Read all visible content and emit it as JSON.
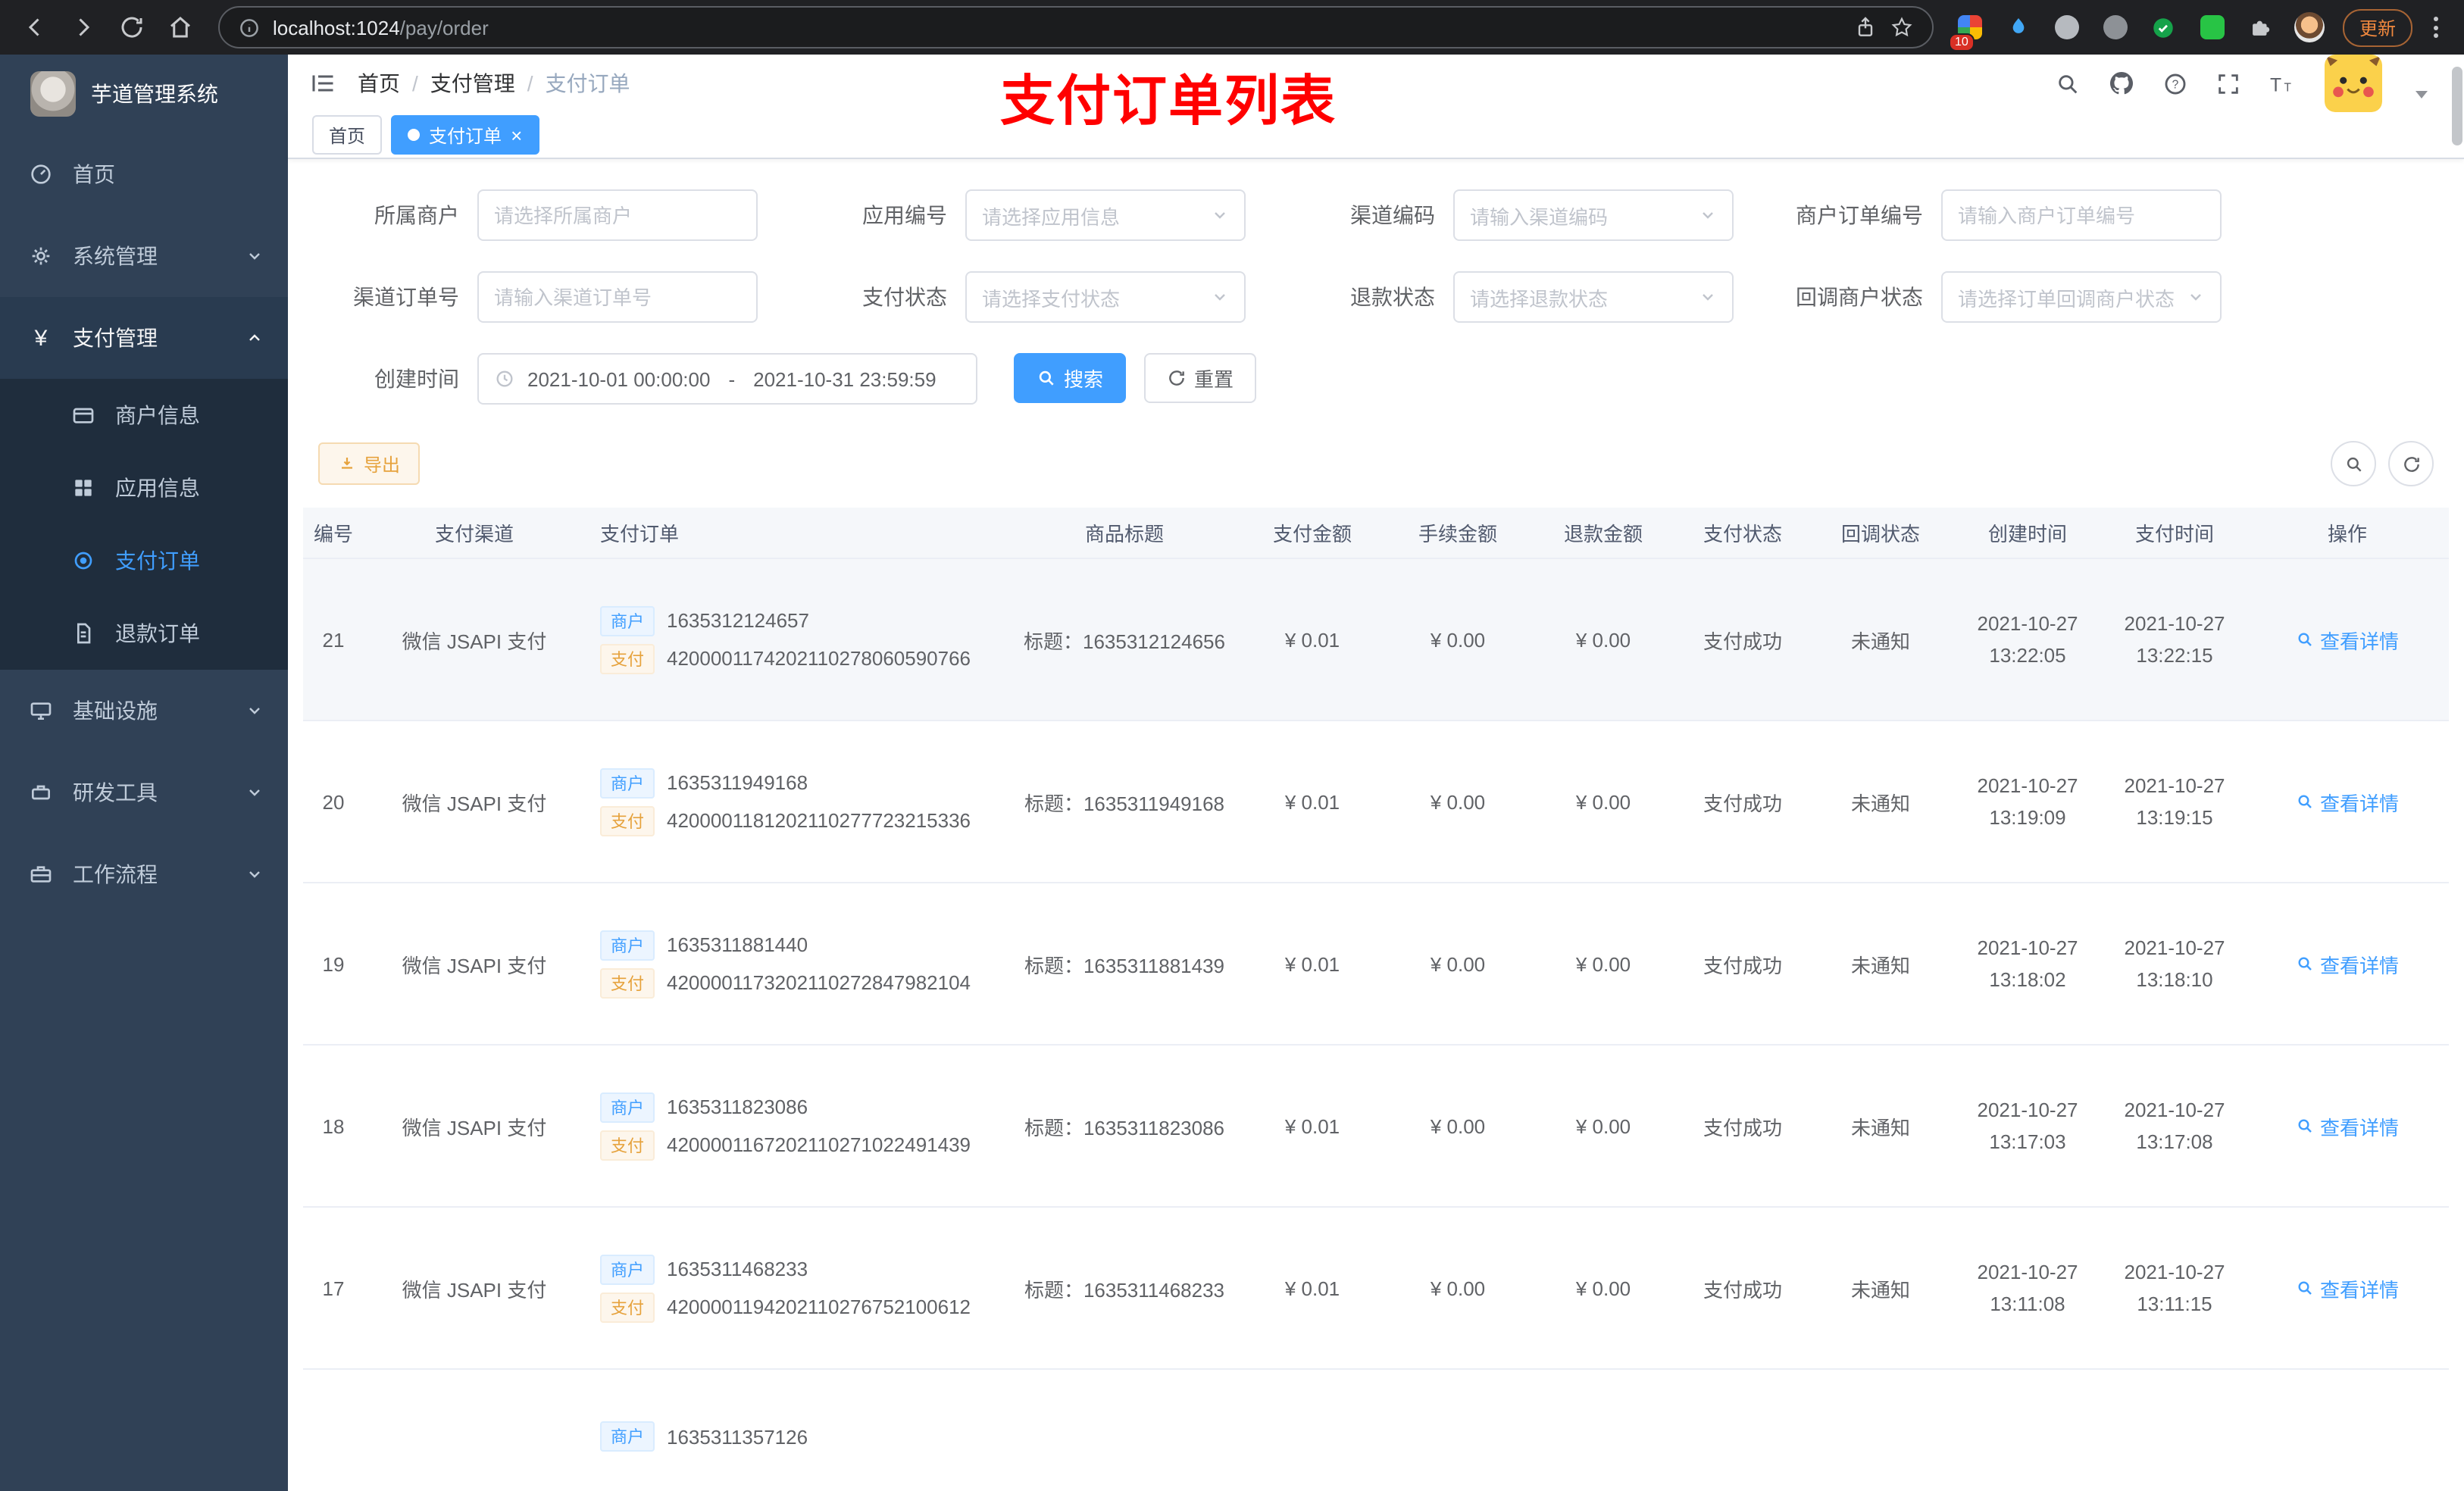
{
  "browser": {
    "url_host": "localhost:1024",
    "url_path": "/pay/order",
    "extension_badge": "10",
    "update_label": "更新"
  },
  "app": {
    "logo_title": "芋道管理系统"
  },
  "sidebar": {
    "items": [
      {
        "label": "首页"
      },
      {
        "label": "系统管理"
      },
      {
        "label": "支付管理"
      },
      {
        "label": "基础设施"
      },
      {
        "label": "研发工具"
      },
      {
        "label": "工作流程"
      }
    ],
    "submenu": [
      {
        "label": "商户信息"
      },
      {
        "label": "应用信息"
      },
      {
        "label": "支付订单"
      },
      {
        "label": "退款订单"
      }
    ]
  },
  "header": {
    "breadcrumb": [
      "首页",
      "支付管理",
      "支付订单"
    ],
    "separator": "/",
    "annotation": "支付订单列表"
  },
  "tabs": [
    {
      "label": "首页"
    },
    {
      "label": "支付订单"
    }
  ],
  "icons": {
    "pay_menu_glyph": "¥",
    "close_glyph": "×",
    "help_glyph": "?"
  },
  "filters": {
    "merchant": {
      "label": "所属商户",
      "placeholder": "请选择所属商户"
    },
    "app_no": {
      "label": "应用编号",
      "placeholder": "请选择应用信息"
    },
    "channel_code": {
      "label": "渠道编码",
      "placeholder": "请输入渠道编码"
    },
    "merchant_order_no": {
      "label": "商户订单编号",
      "placeholder": "请输入商户订单编号"
    },
    "channel_order_no": {
      "label": "渠道订单号",
      "placeholder": "请输入渠道订单号"
    },
    "pay_status": {
      "label": "支付状态",
      "placeholder": "请选择支付状态"
    },
    "refund_status": {
      "label": "退款状态",
      "placeholder": "请选择退款状态"
    },
    "callback_status": {
      "label": "回调商户状态",
      "placeholder": "请选择订单回调商户状态"
    },
    "create_time": {
      "label": "创建时间",
      "start": "2021-10-01 00:00:00",
      "separator": "-",
      "end": "2021-10-31 23:59:59"
    },
    "search_label": "搜索",
    "reset_label": "重置"
  },
  "toolbar": {
    "export_label": "导出"
  },
  "table": {
    "headers": [
      "编号",
      "支付渠道",
      "支付订单",
      "商品标题",
      "支付金额",
      "手续金额",
      "退款金额",
      "支付状态",
      "回调状态",
      "创建时间",
      "支付时间",
      "操作"
    ],
    "merchant_tag": "商户",
    "pay_tag": "支付",
    "action_label": "查看详情",
    "rows": [
      {
        "id": "21",
        "channel": "微信 JSAPI 支付",
        "merchant_no": "1635312124657",
        "channel_no": "4200001174202110278060590766",
        "title": "标题：1635312124656",
        "amount": "¥ 0.01",
        "fee": "¥ 0.00",
        "refund": "¥ 0.00",
        "status": "支付成功",
        "notify": "未通知",
        "create_date": "2021-10-27",
        "create_time": "13:22:05",
        "pay_date": "2021-10-27",
        "pay_time": "13:22:15"
      },
      {
        "id": "20",
        "channel": "微信 JSAPI 支付",
        "merchant_no": "1635311949168",
        "channel_no": "4200001181202110277723215336",
        "title": "标题：1635311949168",
        "amount": "¥ 0.01",
        "fee": "¥ 0.00",
        "refund": "¥ 0.00",
        "status": "支付成功",
        "notify": "未通知",
        "create_date": "2021-10-27",
        "create_time": "13:19:09",
        "pay_date": "2021-10-27",
        "pay_time": "13:19:15"
      },
      {
        "id": "19",
        "channel": "微信 JSAPI 支付",
        "merchant_no": "1635311881440",
        "channel_no": "4200001173202110272847982104",
        "title": "标题：1635311881439",
        "amount": "¥ 0.01",
        "fee": "¥ 0.00",
        "refund": "¥ 0.00",
        "status": "支付成功",
        "notify": "未通知",
        "create_date": "2021-10-27",
        "create_time": "13:18:02",
        "pay_date": "2021-10-27",
        "pay_time": "13:18:10"
      },
      {
        "id": "18",
        "channel": "微信 JSAPI 支付",
        "merchant_no": "1635311823086",
        "channel_no": "4200001167202110271022491439",
        "title": "标题：1635311823086",
        "amount": "¥ 0.01",
        "fee": "¥ 0.00",
        "refund": "¥ 0.00",
        "status": "支付成功",
        "notify": "未通知",
        "create_date": "2021-10-27",
        "create_time": "13:17:03",
        "pay_date": "2021-10-27",
        "pay_time": "13:17:08"
      },
      {
        "id": "17",
        "channel": "微信 JSAPI 支付",
        "merchant_no": "1635311468233",
        "channel_no": "4200001194202110276752100612",
        "title": "标题：1635311468233",
        "amount": "¥ 0.01",
        "fee": "¥ 0.00",
        "refund": "¥ 0.00",
        "status": "支付成功",
        "notify": "未通知",
        "create_date": "2021-10-27",
        "create_time": "13:11:08",
        "pay_date": "2021-10-27",
        "pay_time": "13:11:15"
      }
    ],
    "partial_row": {
      "merchant_no": "1635311357126"
    }
  }
}
